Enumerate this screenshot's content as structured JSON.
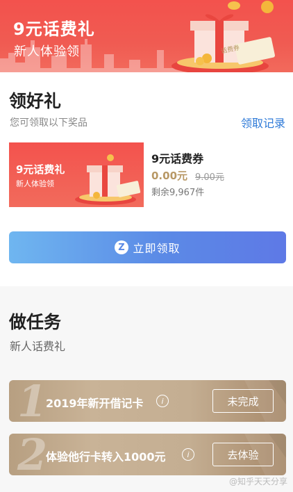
{
  "banner": {
    "title": "9元话费礼",
    "subtitle": "新人体验领",
    "ticket_text": "话费券"
  },
  "gift_section": {
    "title": "领好礼",
    "subtitle": "您可领取以下奖品",
    "link": "领取记录"
  },
  "prize": {
    "thumb_title": "9元话费礼",
    "thumb_subtitle": "新人体验领",
    "name": "9元话费券",
    "price": "0.00元",
    "original_price": "9.00元",
    "stock": "剩余9,967件"
  },
  "claim_button": {
    "logo": "Z",
    "label": "立即领取"
  },
  "task_section": {
    "title": "做任务",
    "subtitle": "新人话费礼",
    "tasks": [
      {
        "number": "1",
        "label": "2019年新开借记卡",
        "action": "未完成"
      },
      {
        "number": "2",
        "label": "体验他行卡转入1000元",
        "action": "去体验"
      }
    ]
  },
  "watermark": "@知乎天天分享",
  "colors": {
    "banner_red": "#f3524d",
    "link_blue": "#2e7ad8",
    "price_gold": "#b89865",
    "button_blue": "#5b8ae6",
    "task_gold": "#c4ae92"
  },
  "icons": [
    "info-icon",
    "gift-box-icon",
    "coin-icon"
  ]
}
